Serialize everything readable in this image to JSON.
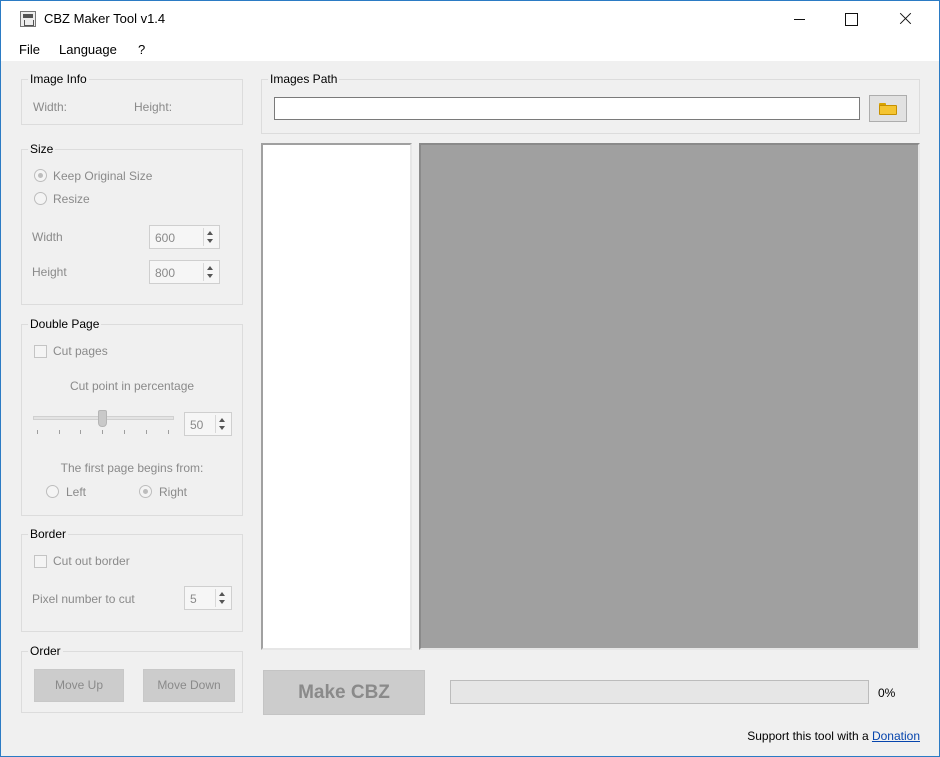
{
  "window": {
    "title": "CBZ Maker Tool  v1.4"
  },
  "menu": {
    "file": "File",
    "language": "Language",
    "help": "?"
  },
  "image_info": {
    "title": "Image Info",
    "width_label": "Width:",
    "height_label": "Height:"
  },
  "size": {
    "title": "Size",
    "keep_original": "Keep Original Size",
    "resize": "Resize",
    "width_label": "Width",
    "width_value": "600",
    "height_label": "Height",
    "height_value": "800"
  },
  "double_page": {
    "title": "Double Page",
    "cut_pages": "Cut pages",
    "cut_point_label": "Cut point in percentage",
    "cut_point_value": "50",
    "cut_point_percent": 50,
    "first_page_label": "The first page begins from:",
    "left": "Left",
    "right": "Right"
  },
  "border": {
    "title": "Border",
    "cut_border": "Cut out border",
    "pixel_label": "Pixel number to cut",
    "pixel_value": "5"
  },
  "order": {
    "title": "Order",
    "move_up": "Move Up",
    "move_down": "Move Down"
  },
  "images_path": {
    "title": "Images Path",
    "value": ""
  },
  "actions": {
    "make_cbz": "Make CBZ"
  },
  "progress": {
    "percent": 0,
    "label": "0%"
  },
  "footer": {
    "support_text": "Support this tool with a ",
    "donation_link": "Donation"
  },
  "colors": {
    "window_bg": "#f0f0f0",
    "preview_bg": "#a0a0a0",
    "accent_border": "#2b7bc4",
    "link": "#0645ad"
  }
}
